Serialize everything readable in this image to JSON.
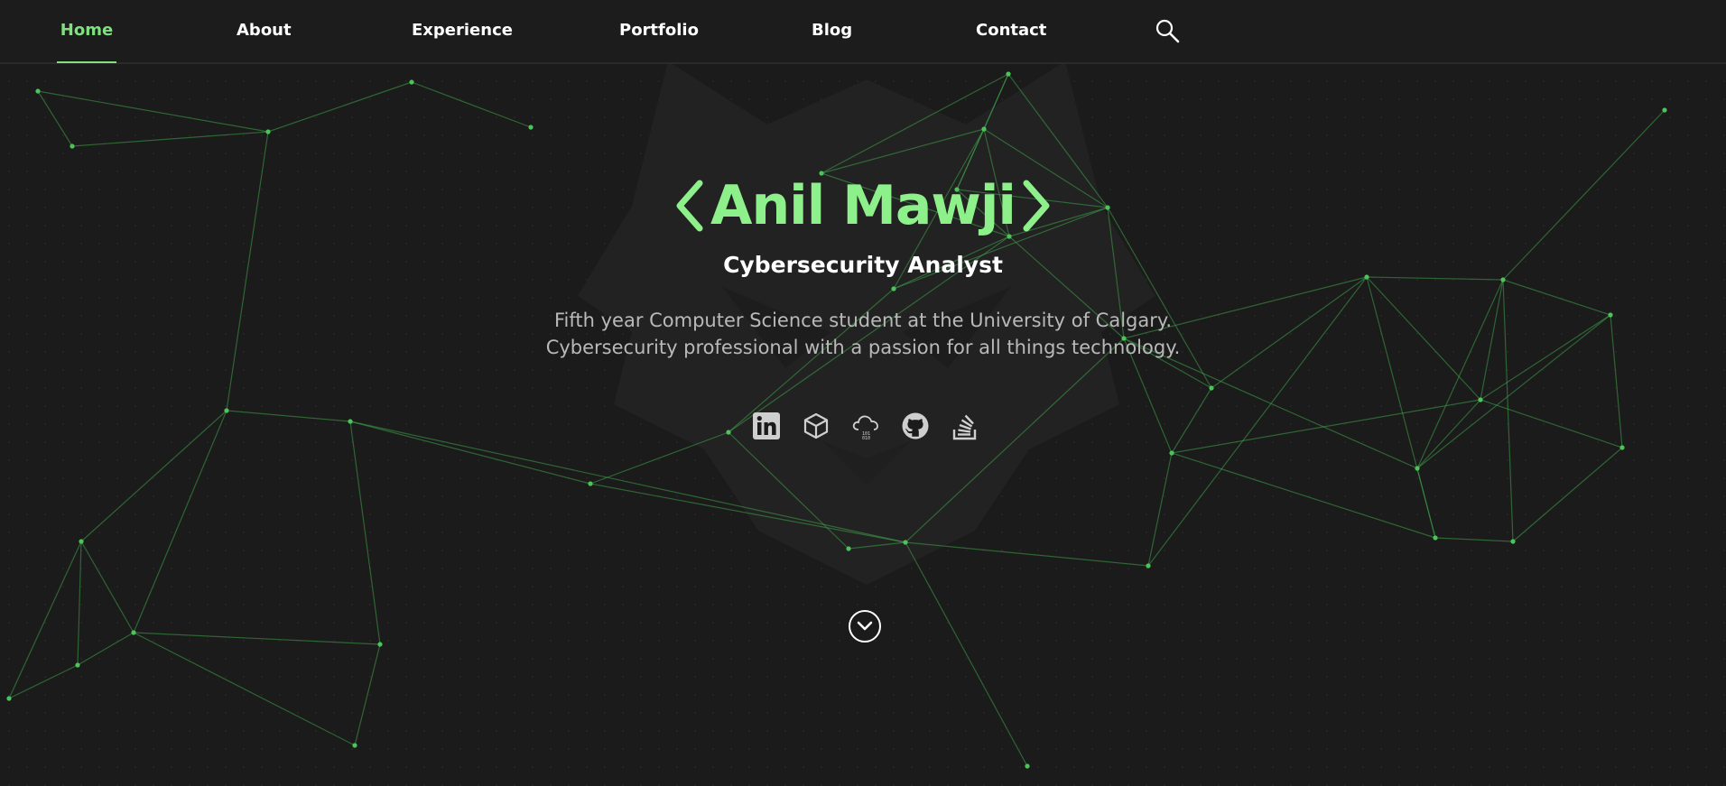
{
  "nav": {
    "items": [
      {
        "label": "Home",
        "active": true
      },
      {
        "label": "About",
        "active": false
      },
      {
        "label": "Experience",
        "active": false
      },
      {
        "label": "Portfolio",
        "active": false
      },
      {
        "label": "Blog",
        "active": false
      },
      {
        "label": "Contact",
        "active": false
      }
    ],
    "search_icon": "search-icon"
  },
  "hero": {
    "name": "Anil Mawji",
    "title": "Cybersecurity Analyst",
    "description_line1": "Fifth year Computer Science student at the University of Calgary.",
    "description_line2": "Cybersecurity professional with a passion for all things technology."
  },
  "socials": [
    {
      "icon": "linkedin-icon"
    },
    {
      "icon": "cube-icon"
    },
    {
      "icon": "cloud-icon"
    },
    {
      "icon": "github-icon"
    },
    {
      "icon": "stackoverflow-icon"
    }
  ],
  "scroll_icon": "chevron-down-icon",
  "colors": {
    "background": "#1b1b1b",
    "accent": "#8ef08a",
    "nav_active": "#7ee07f",
    "network_line": "#3fa34a",
    "network_node": "#4cc45a"
  }
}
